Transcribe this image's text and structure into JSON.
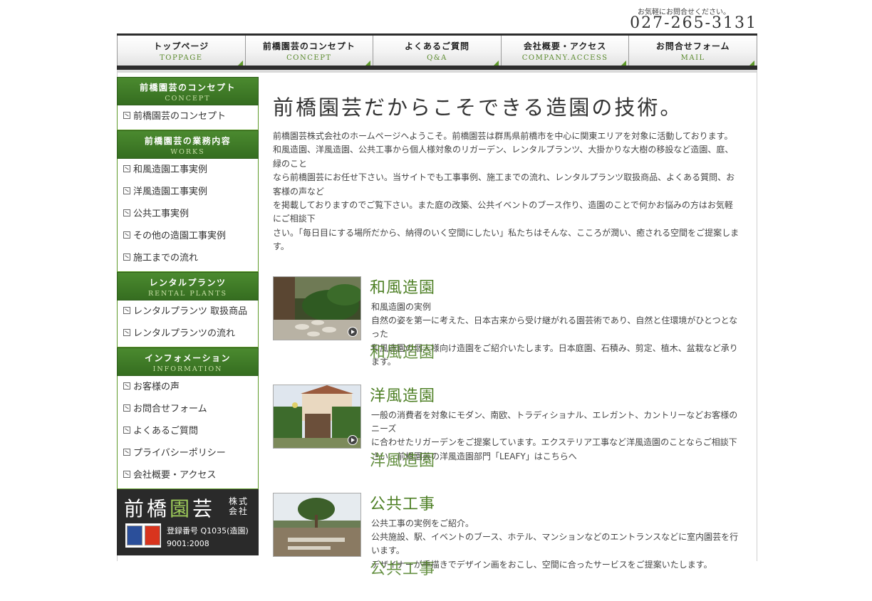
{
  "header": {
    "contact_note": "お気軽にお問合せください。",
    "tel": "027-265-3131"
  },
  "nav": [
    {
      "jp": "トップページ",
      "en": "TOPPAGE"
    },
    {
      "jp": "前橋園芸のコンセプト",
      "en": "CONCEPT"
    },
    {
      "jp": "よくあるご質問",
      "en": "Q&A"
    },
    {
      "jp": "会社概要・アクセス",
      "en": "COMPANY.ACCESS"
    },
    {
      "jp": "お問合せフォーム",
      "en": "MAIL"
    }
  ],
  "sidebar": {
    "concept": {
      "jp": "前橋園芸のコンセプト",
      "en": "CONCEPT",
      "items": [
        "前橋園芸のコンセプト"
      ]
    },
    "works": {
      "jp": "前橋園芸の業務内容",
      "en": "WORKS",
      "items": [
        "和風造園工事実例",
        "洋風造園工事実例",
        "公共工事実例",
        "その他の造園工事実例",
        "施工までの流れ"
      ]
    },
    "rental": {
      "jp": "レンタルプランツ",
      "en": "RENTAL PLANTS",
      "items": [
        "レンタルプランツ 取扱商品",
        "レンタルプランツの流れ"
      ]
    },
    "info": {
      "jp": "インフォメーション",
      "en": "INFORMATION",
      "items": [
        "お客様の声",
        "お問合せフォーム",
        "よくあるご質問",
        "プライバシーポリシー",
        "会社概要・アクセス"
      ]
    },
    "logo": {
      "name_1": "前橋",
      "name_accent": "園",
      "name_2": "芸",
      "suffix_1": "株式",
      "suffix_2": "会社",
      "reg_line_1": "登録番号 Q1035(造園)",
      "reg_line_2": "9001:2008"
    }
  },
  "main": {
    "title": "前橋園芸だからこそできる造園の技術。",
    "intro": [
      "前橋園芸株式会社のホームページへようこそ。前橋園芸は群馬県前橋市を中心に関東エリアを対象に活動しております。",
      "和風造園、洋風造園、公共工事から個人様対象のリガーデン、レンタルプランツ、大掛かりな大樹の移設など造園、庭、緑のこと",
      "なら前橋園芸にお任せ下さい。当サイトでも工事事例、施工までの流れ、レンタルプランツ取扱商品、よくある質問、お客様の声など",
      "を掲載しておりますのでご覧下さい。また庭の改築、公共イベントのブース作り、造園のことで何かお悩みの方はお気軽にご相談下",
      "さい。「毎日目にする場所だから、納得のいく空間にしたい」私たちはそんな、こころが潤い、癒される空間をご提案します。"
    ],
    "sections": [
      {
        "title": "和風造園",
        "lines": [
          "和風造園の実例",
          "自然の姿を第一に考えた、日本古来から受け継がれる園芸術であり、自然と住環境がひとつとなった",
          "和風造園の個人様向け造園をご紹介いたします。日本庭園、石積み、剪定、植木、盆栽など承ります。"
        ]
      },
      {
        "title": "洋風造園",
        "lines": [
          "一般の消費者を対象にモダン、南欧、トラディショナル、エレガント、カントリーなどお客様のニーズ",
          "に合わせたリガーデンをご提案しています。エクステリア工事など洋風造園のことならご相談下さい。前橋園芸の洋風造園部門「LEAFY」はこちらへ"
        ]
      },
      {
        "title": "公共工事",
        "lines": [
          "公共工事の実例をご紹介。",
          "公共施設、駅、イベントのブース、ホテル、マンションなどのエントランスなどに室内園芸を行います。",
          "デザイナーが手描きでデザイン画をおこし、空間に合ったサービスをご提案いたします。"
        ]
      }
    ]
  },
  "colors": {
    "accent_green": "#4d7f24",
    "nav_dark": "#2c2c2c",
    "logo_accent": "#9dcb5a"
  }
}
